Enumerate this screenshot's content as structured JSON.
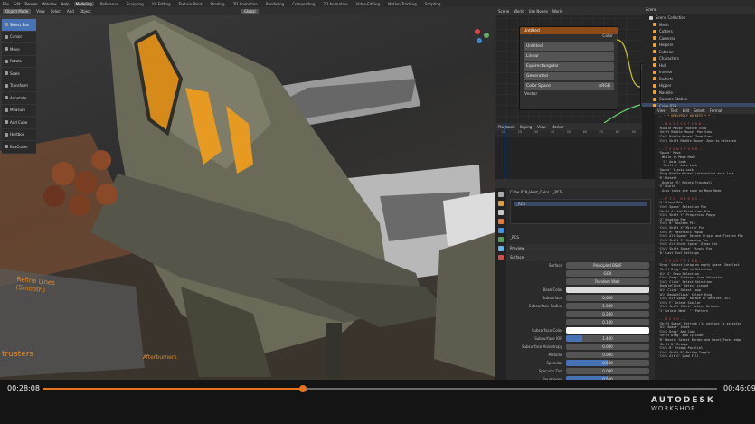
{
  "menu": {
    "items": [
      "File",
      "Edit",
      "Render",
      "Window",
      "Help"
    ],
    "workspaces": [
      "Modeling",
      "Reference",
      "Sculpting",
      "UV Editing",
      "Texture Paint",
      "Shading",
      "3D Animation",
      "Rendering",
      "Compositing",
      "2D Animation",
      "Video Editing",
      "Motion Tracking",
      "Scripting"
    ],
    "active_workspace": "Modeling"
  },
  "viewport_header": {
    "mode": "Object Mode",
    "menus": [
      "View",
      "Select",
      "Add",
      "Object"
    ],
    "orientation": "Global"
  },
  "tools": [
    "Select Box",
    "Cursor",
    "Move",
    "Rotate",
    "Scale",
    "Transform",
    "Annotate",
    "Measure",
    "Add Cube",
    "Hurtbox",
    "BoxCutter"
  ],
  "active_tool": "Select Box",
  "node_editor": {
    "header": [
      "Object",
      "View",
      "Select",
      "Add",
      "Node",
      "Use Nodes",
      "Slot 1",
      "World"
    ],
    "breadcrumb": [
      "Scene",
      "World"
    ],
    "node_title": "Untitled",
    "image_name": "Untitled",
    "output_label": "Color",
    "interpolation": "Linear",
    "projection": "Equirectangular",
    "source": "Generated",
    "color_space_label": "Color Space",
    "color_space": "sRGB",
    "vector_label": "Vector",
    "bsdf_labels": [
      "Wo",
      "All",
      "Surfa",
      "Volum"
    ]
  },
  "timeline": {
    "header": [
      "Playback",
      "Keying",
      "View",
      "Marker"
    ],
    "frames": [
      "10",
      "20",
      "30",
      "40",
      "50",
      "60",
      "70",
      "80",
      "90"
    ]
  },
  "properties": {
    "material_path": "Cube.029_Hunt_Color",
    "slot": "_RCS",
    "material_name": "_RCS",
    "sections": [
      "Preview",
      "Surface"
    ],
    "surface": "Principled BSDF",
    "distribution": "GGX",
    "subsurface_method": "Random Walk",
    "rows": [
      {
        "label": "Base Color",
        "value": ""
      },
      {
        "label": "Subsurface",
        "value": "0.000"
      },
      {
        "label": "Subsurface Radius",
        "value": "1.000"
      },
      {
        "label": "",
        "value": "0.200"
      },
      {
        "label": "",
        "value": "0.100"
      },
      {
        "label": "Subsurface Color",
        "value": ""
      },
      {
        "label": "Subsurface IOR",
        "value": "1.400"
      },
      {
        "label": "Subsurface Anisotropy",
        "value": "0.000"
      },
      {
        "label": "Metallic",
        "value": "0.000"
      },
      {
        "label": "Specular",
        "value": "0.500"
      },
      {
        "label": "Specular Tint",
        "value": "0.000"
      },
      {
        "label": "Roughness",
        "value": "0.500"
      }
    ]
  },
  "outliner": {
    "title": "Scene",
    "view_layer": "ViewLayer",
    "items": [
      "Scene Collection",
      "Mesh",
      "Cutters",
      "Cameras",
      "Helpers",
      "Exterior",
      "Characters",
      "Hull",
      "Interior",
      "Bartists",
      "Hipper",
      "Nacelle",
      "Console Station",
      "Cube.029"
    ],
    "selected": "Cube.029"
  },
  "text_editor": {
    "header": [
      "View",
      "Text",
      "Edit",
      "Select",
      "Format",
      "Templates"
    ],
    "lines": [
      {
        "t": "-- * * HEAVYPOLY HOTKEYS * * --",
        "k": "h"
      },
      {
        "t": "",
        "k": ""
      },
      {
        "t": "--- N A V I G A T I O N ---",
        "k": "r"
      },
      {
        "t": "'Middle Mouse' Rotate View",
        "k": ""
      },
      {
        "t": "'Shift Middle Mouse' Pan View",
        "k": ""
      },
      {
        "t": "'Ctrl Middle Mouse' Zoom View",
        "k": ""
      },
      {
        "t": "'Ctrl Shift Middle Mouse' Zoom to Selected",
        "k": ""
      },
      {
        "t": "",
        "k": ""
      },
      {
        "t": "--- T R A N S F O R M ---",
        "k": "r"
      },
      {
        "t": "'Space' Move",
        "k": ""
      },
      {
        "t": "  While in Move Mode",
        "k": ""
      },
      {
        "t": "  'X' Axis Lock",
        "k": ""
      },
      {
        "t": "  'Shift X' Axis Lock",
        "k": ""
      },
      {
        "t": "'Space' Y axis Lock",
        "k": ""
      },
      {
        "t": "'Drag Middle Mouse' interactive axis lock",
        "k": ""
      },
      {
        "t": "'R' Rotate",
        "k": ""
      },
      {
        "t": "  Double 'R' Rotate Trackball",
        "k": ""
      },
      {
        "t": "'S' Scale",
        "k": ""
      },
      {
        "t": "  Axis locks are same as Move Mode",
        "k": ""
      },
      {
        "t": "",
        "k": ""
      },
      {
        "t": "--- P I E   M E N U S ---",
        "k": "r"
      },
      {
        "t": "'Q' Views Pie",
        "k": ""
      },
      {
        "t": "'Ctrl Space' Selection Pie",
        "k": ""
      },
      {
        "t": "'Shift A' Add Primitives Pie",
        "k": ""
      },
      {
        "t": "'Ctrl Shift Y' Properties Popup",
        "k": ""
      },
      {
        "t": "'Z' Shading Pie",
        "k": ""
      },
      {
        "t": "'Ctrl B' Boolean Pie",
        "k": ""
      },
      {
        "t": "'Ctrl Shift X' Mirror Pie",
        "k": ""
      },
      {
        "t": "'Ctrl M' Materials Popup",
        "k": ""
      },
      {
        "t": "'Ctrl Alt Space' Rotate Origin and Flatten Pie",
        "k": ""
      },
      {
        "t": "'Ctrl Shift S' Snapping Pie",
        "k": ""
      },
      {
        "t": "'Ctrl Alt Shift Space' Areas Pie",
        "k": ""
      },
      {
        "t": "'Ctrl Shift Space' Pivots Pie",
        "k": ""
      },
      {
        "t": "'D' Last Tool Settings",
        "k": ""
      },
      {
        "t": "",
        "k": ""
      },
      {
        "t": "--- S E L E C T I O N ---",
        "k": "r"
      },
      {
        "t": "'Drag' Select (drag on empty space) Deselect",
        "k": ""
      },
      {
        "t": "'Shift Drag' Add to Selection",
        "k": ""
      },
      {
        "t": "'Alt G' Grow Selection",
        "k": ""
      },
      {
        "t": "'Ctrl Drag' Subtract from Selection",
        "k": ""
      },
      {
        "t": "'Ctrl Click' Select Selection",
        "k": ""
      },
      {
        "t": "'DoubleClick' Select Linked",
        "k": ""
      },
      {
        "t": "'Alt Click' Select Loop",
        "k": ""
      },
      {
        "t": "'Alt DoubleClick' Select Ring",
        "k": ""
      },
      {
        "t": "'Ctrl Alt Space' Rotate Or Deselect All",
        "k": ""
      },
      {
        "t": "'Ctrl F' Select Similar",
        "k": ""
      },
      {
        "t": "'Ctrl Shift Click' Select Between",
        "k": ""
      },
      {
        "t": "'1' Select Next  '' Pattern",
        "k": ""
      },
      {
        "t": "",
        "k": ""
      },
      {
        "t": "--- M E S H ---",
        "k": "r"
      },
      {
        "t": "'Shift Space' Extrude (1) nothing is selected",
        "k": ""
      },
      {
        "t": "'Alt Space' Inset",
        "k": ""
      },
      {
        "t": "'Ctrl Drag' Add Cube",
        "k": ""
      },
      {
        "t": "'Shift Drag' Add Cylinder",
        "k": ""
      },
      {
        "t": "'B' Bevel: Select Border and Bevel/Faces edge",
        "k": ""
      },
      {
        "t": "'Shift B' Bridge",
        "k": ""
      },
      {
        "t": "'Ctrl B' Bridge Parallel",
        "k": ""
      },
      {
        "t": "'Ctrl Shift B' Bridge Toggle",
        "k": ""
      },
      {
        "t": "'Ctrl Alt G' Quad Fill",
        "k": ""
      }
    ]
  },
  "viewport_overlay": {
    "notes": [
      "Refine Lines",
      "(Smooth)",
      "trusters",
      "Afterburners"
    ]
  },
  "video": {
    "current": "00:28:08",
    "total": "00:46:09",
    "progress": 0.385,
    "brand_top": "AUTODESK",
    "brand_bottom": "WORKSHOP"
  },
  "colors": {
    "accent": "#e8731e",
    "blender_blue": "#4772b3",
    "texture_node": "#8c4a16"
  }
}
